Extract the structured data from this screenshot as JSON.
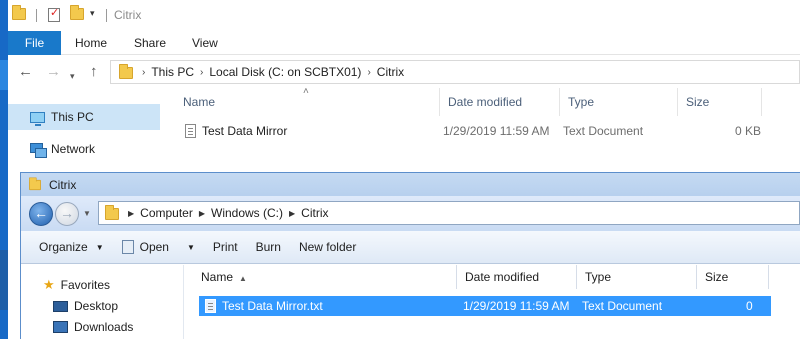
{
  "top_window": {
    "title": "Citrix",
    "tabs": {
      "file": "File",
      "home": "Home",
      "share": "Share",
      "view": "View"
    },
    "breadcrumb": [
      "This PC",
      "Local Disk (C: on SCBTX01)",
      "Citrix"
    ],
    "nav": [
      {
        "label": "This PC",
        "icon": "pc-icon",
        "selected": true
      },
      {
        "label": "Network",
        "icon": "network-icon",
        "selected": false
      }
    ],
    "columns": {
      "name": "Name",
      "date": "Date modified",
      "type": "Type",
      "size": "Size"
    },
    "rows": [
      {
        "name": "Test Data Mirror",
        "date": "1/29/2019 11:59 AM",
        "type": "Text Document",
        "size": "0 KB"
      }
    ]
  },
  "bottom_window": {
    "title": "Citrix",
    "breadcrumb": [
      "Computer",
      "Windows (C:)",
      "Citrix"
    ],
    "commands": {
      "organize": "Organize",
      "open": "Open",
      "print": "Print",
      "burn": "Burn",
      "new_folder": "New folder"
    },
    "nav": {
      "favorites": "Favorites",
      "desktop": "Desktop",
      "downloads": "Downloads"
    },
    "columns": {
      "name": "Name",
      "date": "Date modified",
      "type": "Type",
      "size": "Size"
    },
    "rows": [
      {
        "name": "Test Data Mirror.txt",
        "date": "1/29/2019 11:59 AM",
        "type": "Text Document",
        "size": "0 KB",
        "selected": true
      }
    ],
    "selection_color": "#3399ff"
  }
}
